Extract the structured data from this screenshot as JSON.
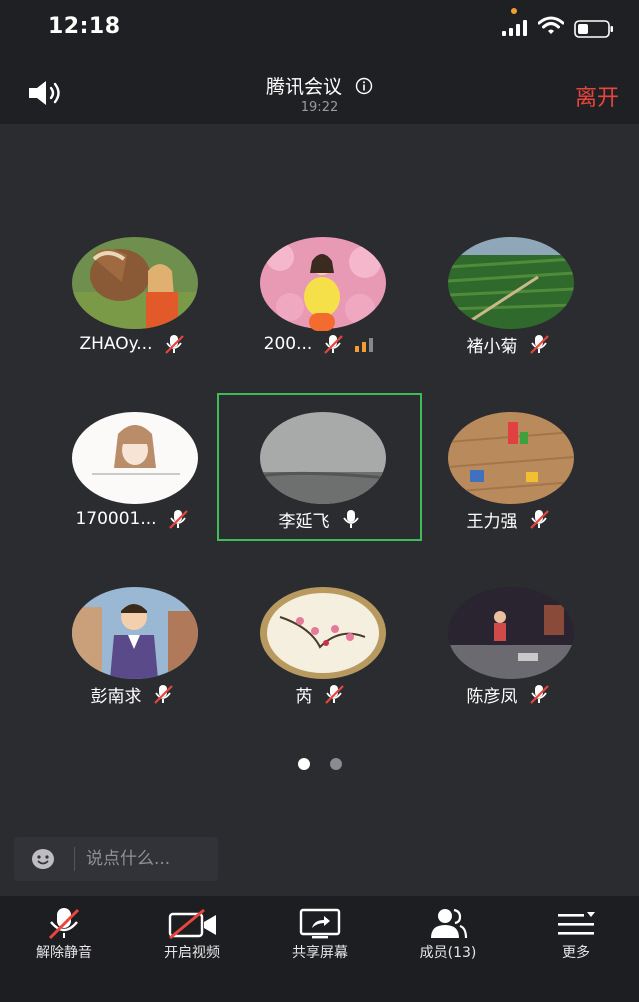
{
  "status_bar": {
    "time": "12:18"
  },
  "header": {
    "title": "腾讯会议",
    "duration": "19:22",
    "leave_label": "离开"
  },
  "participants": [
    {
      "name": "ZHAOy...",
      "muted": true,
      "avatar": "horse-photo"
    },
    {
      "name": "200...",
      "muted": true,
      "avatar": "pink-flowers-photo",
      "host": true,
      "signal": true
    },
    {
      "name": "褚小菊",
      "muted": true,
      "avatar": "green-field-photo"
    },
    {
      "name": "170001...",
      "muted": true,
      "avatar": "cartoon-girl"
    },
    {
      "name": "李延飞",
      "muted": false,
      "avatar": "grey-sky-photo",
      "speaking": true
    },
    {
      "name": "王力强",
      "muted": true,
      "avatar": "toys-floor-photo"
    },
    {
      "name": "彭南求",
      "muted": true,
      "avatar": "cartoon-man"
    },
    {
      "name": "芮",
      "muted": true,
      "avatar": "plum-blossom-painting"
    },
    {
      "name": "陈彦凤",
      "muted": true,
      "avatar": "night-street-photo"
    }
  ],
  "pagination": {
    "current": 1,
    "total": 2
  },
  "chat": {
    "placeholder": "说点什么..."
  },
  "toolbar": {
    "unmute_label": "解除静音",
    "video_label": "开启视频",
    "share_label": "共享屏幕",
    "members_label": "成员(13)",
    "more_label": "更多"
  },
  "colors": {
    "accent_leave": "#e8453c",
    "active_speaker_border": "#3fbb59",
    "muted_slash": "#e8453c",
    "signal_orange": "#f39c34"
  }
}
